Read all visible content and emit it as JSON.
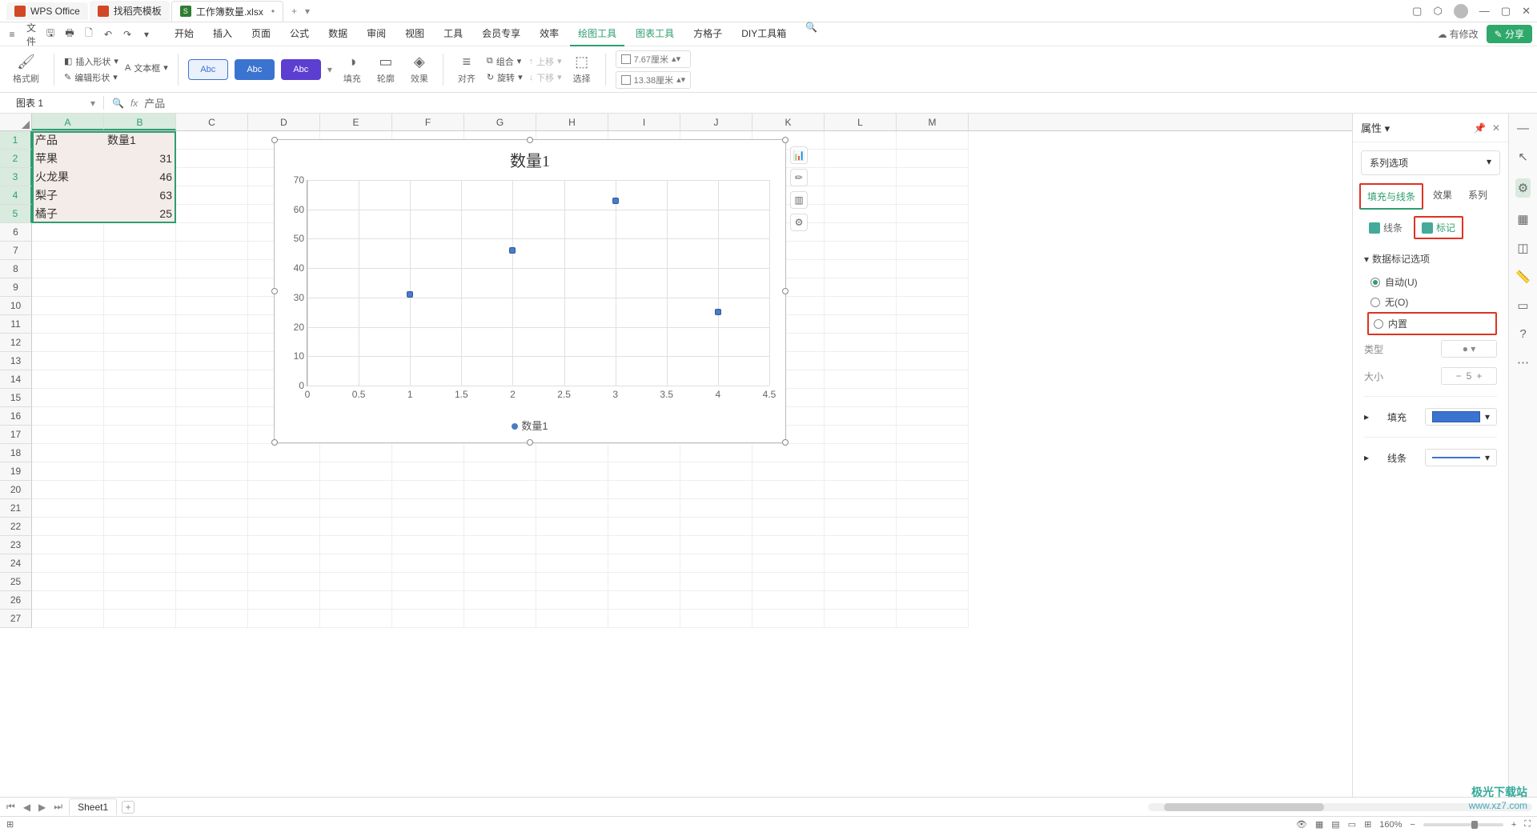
{
  "title_bar": {
    "app": "WPS Office",
    "tabs": [
      {
        "icon": "d",
        "label": "找稻壳模板"
      },
      {
        "icon": "s",
        "label": "工作簿数量.xlsx",
        "active": true,
        "dirty": "•"
      }
    ],
    "new_tab": "+"
  },
  "menu_bar": {
    "file": "文件",
    "tabs": [
      "开始",
      "插入",
      "页面",
      "公式",
      "数据",
      "审阅",
      "视图",
      "工具",
      "会员专享",
      "效率",
      "绘图工具",
      "图表工具",
      "方格子",
      "DIY工具箱"
    ],
    "active_tab": "绘图工具",
    "modify": "有修改",
    "share": "分享"
  },
  "ribbon": {
    "format_painter": "格式刷",
    "insert_shape": "插入形状",
    "text_box": "文本框",
    "edit_shape": "编辑形状",
    "abc": "Abc",
    "fill": "填充",
    "outline": "轮廓",
    "effect": "效果",
    "align": "对齐",
    "group": "组合",
    "rotate": "旋转",
    "move_up": "上移",
    "move_down": "下移",
    "select": "选择",
    "width": "7.67厘米",
    "height": "13.38厘米"
  },
  "formula_bar": {
    "name": "图表 1",
    "fx": "fx",
    "value": "产品"
  },
  "grid": {
    "cols": [
      "A",
      "B",
      "C",
      "D",
      "E",
      "F",
      "G",
      "H",
      "I",
      "J",
      "K",
      "L",
      "M"
    ],
    "rows": 27,
    "data": [
      [
        "产品",
        "数量1"
      ],
      [
        "苹果",
        "31"
      ],
      [
        "火龙果",
        "46"
      ],
      [
        "梨子",
        "63"
      ],
      [
        "橘子",
        "25"
      ]
    ]
  },
  "chart_data": {
    "type": "scatter",
    "title": "数量1",
    "x": [
      1,
      2,
      3,
      4
    ],
    "values": [
      31,
      46,
      63,
      25
    ],
    "xticks": [
      0,
      0.5,
      1,
      1.5,
      2,
      2.5,
      3,
      3.5,
      4,
      4.5
    ],
    "yticks": [
      0,
      10,
      20,
      30,
      40,
      50,
      60,
      70
    ],
    "ylim": [
      0,
      70
    ],
    "xlim": [
      0,
      4.5
    ],
    "legend": "数量1"
  },
  "chart_tools": [
    "📊",
    "✏",
    "▥",
    "⚙"
  ],
  "panel": {
    "title": "属性",
    "series_selector": "系列选项",
    "tabs": [
      "填充与线条",
      "效果",
      "系列"
    ],
    "active_tab": "填充与线条",
    "subtabs": {
      "line": "线条",
      "mark": "标记"
    },
    "section": "数据标记选项",
    "radios": [
      {
        "label": "自动(U)",
        "on": true
      },
      {
        "label": "无(O)",
        "on": false
      },
      {
        "label": "内置",
        "on": false
      }
    ],
    "type_label": "类型",
    "size_label": "大小",
    "size_value": "5",
    "fill_label": "填充",
    "line_label": "线条"
  },
  "sheet_tabs": {
    "sheet": "Sheet1"
  },
  "status": {
    "zoom": "160%"
  },
  "watermark": {
    "brand": "极光下载站",
    "url": "www.xz7.com"
  }
}
